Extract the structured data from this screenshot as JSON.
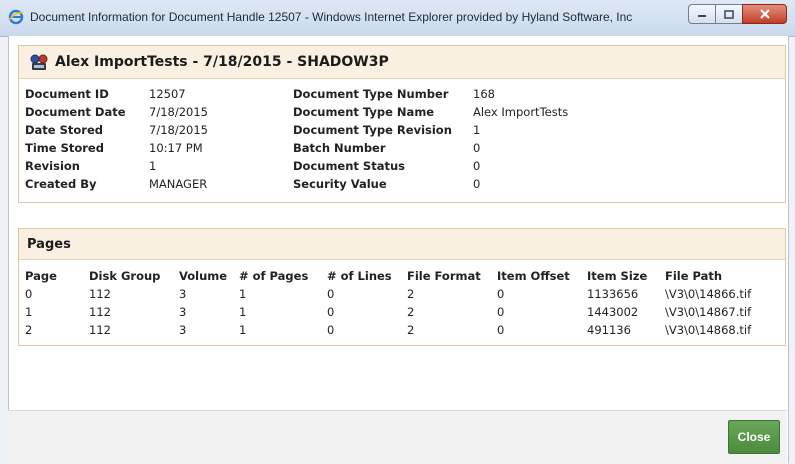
{
  "window": {
    "title": "Document Information for Document Handle 12507 - Windows Internet Explorer provided by Hyland Software, Inc"
  },
  "document": {
    "heading": "Alex ImportTests - 7/18/2015 - SHADOW3P",
    "left_props": [
      {
        "label": "Document ID",
        "value": "12507"
      },
      {
        "label": "Document Date",
        "value": "7/18/2015"
      },
      {
        "label": "Date Stored",
        "value": "7/18/2015"
      },
      {
        "label": "Time Stored",
        "value": "10:17 PM"
      },
      {
        "label": "Revision",
        "value": "1"
      },
      {
        "label": "Created By",
        "value": "MANAGER"
      }
    ],
    "right_props": [
      {
        "label": "Document Type Number",
        "value": "168"
      },
      {
        "label": "Document Type Name",
        "value": "Alex ImportTests"
      },
      {
        "label": "Document Type Revision",
        "value": "1"
      },
      {
        "label": "Batch Number",
        "value": "0"
      },
      {
        "label": "Document Status",
        "value": "0"
      },
      {
        "label": "Security Value",
        "value": "0"
      }
    ]
  },
  "pages": {
    "heading": "Pages",
    "columns": [
      "Page",
      "Disk Group",
      "Volume",
      "# of Pages",
      "# of Lines",
      "File Format",
      "Item Offset",
      "Item Size",
      "File Path"
    ],
    "rows": [
      [
        "0",
        "112",
        "3",
        "1",
        "0",
        "2",
        "0",
        "1133656",
        "\\V3\\0\\14866.tif"
      ],
      [
        "1",
        "112",
        "3",
        "1",
        "0",
        "2",
        "0",
        "1443002",
        "\\V3\\0\\14867.tif"
      ],
      [
        "2",
        "112",
        "3",
        "1",
        "0",
        "2",
        "0",
        "491136",
        "\\V3\\0\\14868.tif"
      ]
    ]
  },
  "footer": {
    "close_label": "Close"
  },
  "colors": {
    "panel_header": "#faf0e2",
    "panel_border": "#e0c7a4",
    "close_button": "#5a9a4c"
  }
}
